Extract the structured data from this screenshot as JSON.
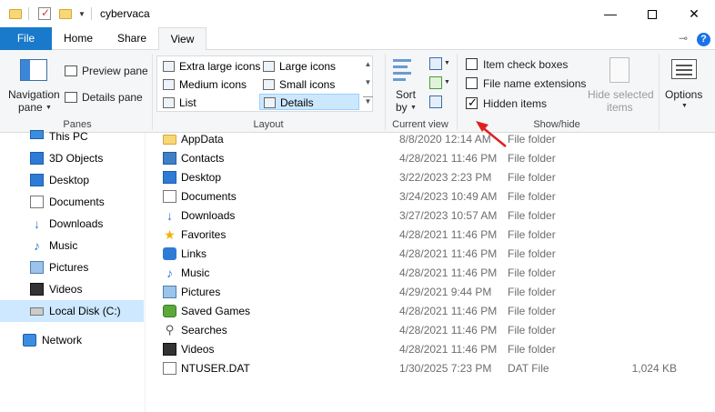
{
  "window": {
    "title": "cybervaca"
  },
  "tabs": {
    "file": "File",
    "home": "Home",
    "share": "Share",
    "view": "View"
  },
  "ribbon": {
    "panes": {
      "navigation_pane_line1": "Navigation",
      "navigation_pane_line2": "pane",
      "preview_pane": "Preview pane",
      "details_pane": "Details pane",
      "group_label": "Panes"
    },
    "layout": {
      "items": [
        "Extra large icons",
        "Large icons",
        "Medium icons",
        "Small icons",
        "List",
        "Details"
      ],
      "selected": "Details",
      "group_label": "Layout"
    },
    "current_view": {
      "sort_line1": "Sort",
      "sort_line2": "by",
      "group_label": "Current view"
    },
    "show_hide": {
      "item_check_boxes": "Item check boxes",
      "file_name_extensions": "File name extensions",
      "hidden_items": "Hidden items",
      "hide_selected_line1": "Hide selected",
      "hide_selected_line2": "items",
      "group_label": "Show/hide",
      "item_check_boxes_checked": false,
      "file_name_extensions_checked": false,
      "hidden_items_checked": true
    },
    "options": {
      "label": "Options"
    }
  },
  "nav": {
    "items": [
      {
        "label": "This PC",
        "icon": "pc-icon"
      },
      {
        "label": "3D Objects",
        "icon": "cube-icon"
      },
      {
        "label": "Desktop",
        "icon": "desktop-icon"
      },
      {
        "label": "Documents",
        "icon": "document-icon"
      },
      {
        "label": "Downloads",
        "icon": "download-icon"
      },
      {
        "label": "Music",
        "icon": "music-icon"
      },
      {
        "label": "Pictures",
        "icon": "picture-icon"
      },
      {
        "label": "Videos",
        "icon": "video-icon"
      },
      {
        "label": "Local Disk (C:)",
        "icon": "disk-icon"
      },
      {
        "label": "Network",
        "icon": "network-icon"
      }
    ],
    "selected": "Local Disk (C:)"
  },
  "files": [
    {
      "name": "AppData",
      "date": "8/8/2020 12:14 AM",
      "type": "File folder",
      "size": ""
    },
    {
      "name": "Contacts",
      "date": "4/28/2021 11:46 PM",
      "type": "File folder",
      "size": ""
    },
    {
      "name": "Desktop",
      "date": "3/22/2023 2:23 PM",
      "type": "File folder",
      "size": ""
    },
    {
      "name": "Documents",
      "date": "3/24/2023 10:49 AM",
      "type": "File folder",
      "size": ""
    },
    {
      "name": "Downloads",
      "date": "3/27/2023 10:57 AM",
      "type": "File folder",
      "size": ""
    },
    {
      "name": "Favorites",
      "date": "4/28/2021 11:46 PM",
      "type": "File folder",
      "size": ""
    },
    {
      "name": "Links",
      "date": "4/28/2021 11:46 PM",
      "type": "File folder",
      "size": ""
    },
    {
      "name": "Music",
      "date": "4/28/2021 11:46 PM",
      "type": "File folder",
      "size": ""
    },
    {
      "name": "Pictures",
      "date": "4/29/2021 9:44 PM",
      "type": "File folder",
      "size": ""
    },
    {
      "name": "Saved Games",
      "date": "4/28/2021 11:46 PM",
      "type": "File folder",
      "size": ""
    },
    {
      "name": "Searches",
      "date": "4/28/2021 11:46 PM",
      "type": "File folder",
      "size": ""
    },
    {
      "name": "Videos",
      "date": "4/28/2021 11:46 PM",
      "type": "File folder",
      "size": ""
    },
    {
      "name": "NTUSER.DAT",
      "date": "1/30/2025 7:23 PM",
      "type": "DAT File",
      "size": "1,024 KB"
    }
  ],
  "colors": {
    "accent": "#1979ca",
    "annotation_arrow": "#e02020",
    "selection": "#cde8ff"
  }
}
